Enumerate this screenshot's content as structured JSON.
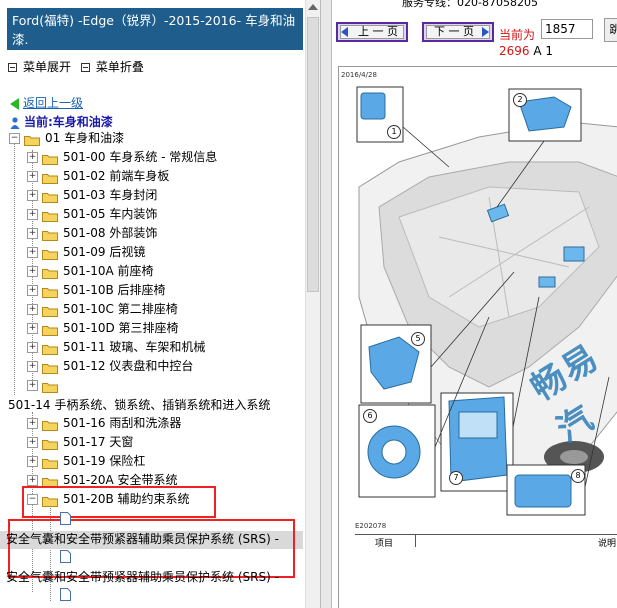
{
  "left_panel": {
    "header_title": "Ford(福特) -Edge（锐界）-2015-2016- 车身和油漆.",
    "menu_expand": "菜单展开",
    "menu_collapse": "菜单折叠",
    "back_link": "返回上一级",
    "current_label": "当前:车身和油漆",
    "tree_root": "01 车身和油漆",
    "tree_items": [
      "501-00 车身系统 - 常规信息",
      "501-02 前端车身板",
      "501-03 车身封闭",
      "501-05 车内装饰",
      "501-08 外部装饰",
      "501-09 后视镜",
      "501-10A 前座椅",
      "501-10B 后排座椅",
      "501-10C 第二排座椅",
      "501-10D 第三排座椅",
      "501-11 玻璃、车架和机械",
      "501-12 仪表盘和中控台"
    ],
    "wrapped_item": "501-14 手柄系统、锁系统、插销系统和进入系统",
    "tree_items2": [
      "501-16 雨刮和洗涤器",
      "501-17 天窗",
      "501-19 保险杠",
      "501-20A 安全带系统",
      "501-20B 辅助约束系统"
    ],
    "srs_doc_1": "安全气囊和安全带预紧器辅助乘员保护系统 (SRS) -",
    "srs_doc_2": "安全气囊和安全带预紧器辅助乘员保护系统 (SRS) -"
  },
  "right_panel": {
    "top_text": "服务专线：020-87058205",
    "prev_button": "上 一 页",
    "next_button": "下 一 页",
    "current_page_label": "当前为",
    "page_value": "1857",
    "jump_label": "跳",
    "total_pages": "2696",
    "page_suffix": "A 1",
    "doc_date": "2016/4/28",
    "doc_code": "E202078",
    "table_col1": "项目",
    "table_col2": "说明",
    "watermark": "畅易汽",
    "callouts": [
      "1",
      "2",
      "5",
      "6",
      "7",
      "8"
    ]
  },
  "colors": {
    "header_bg": "#1f5e8c",
    "link_blue": "#1a62b6",
    "highlight_red": "#e22222",
    "nav_border": "#5a2a9e",
    "page_red": "#d41515",
    "watermark": "#2d7eb8"
  }
}
